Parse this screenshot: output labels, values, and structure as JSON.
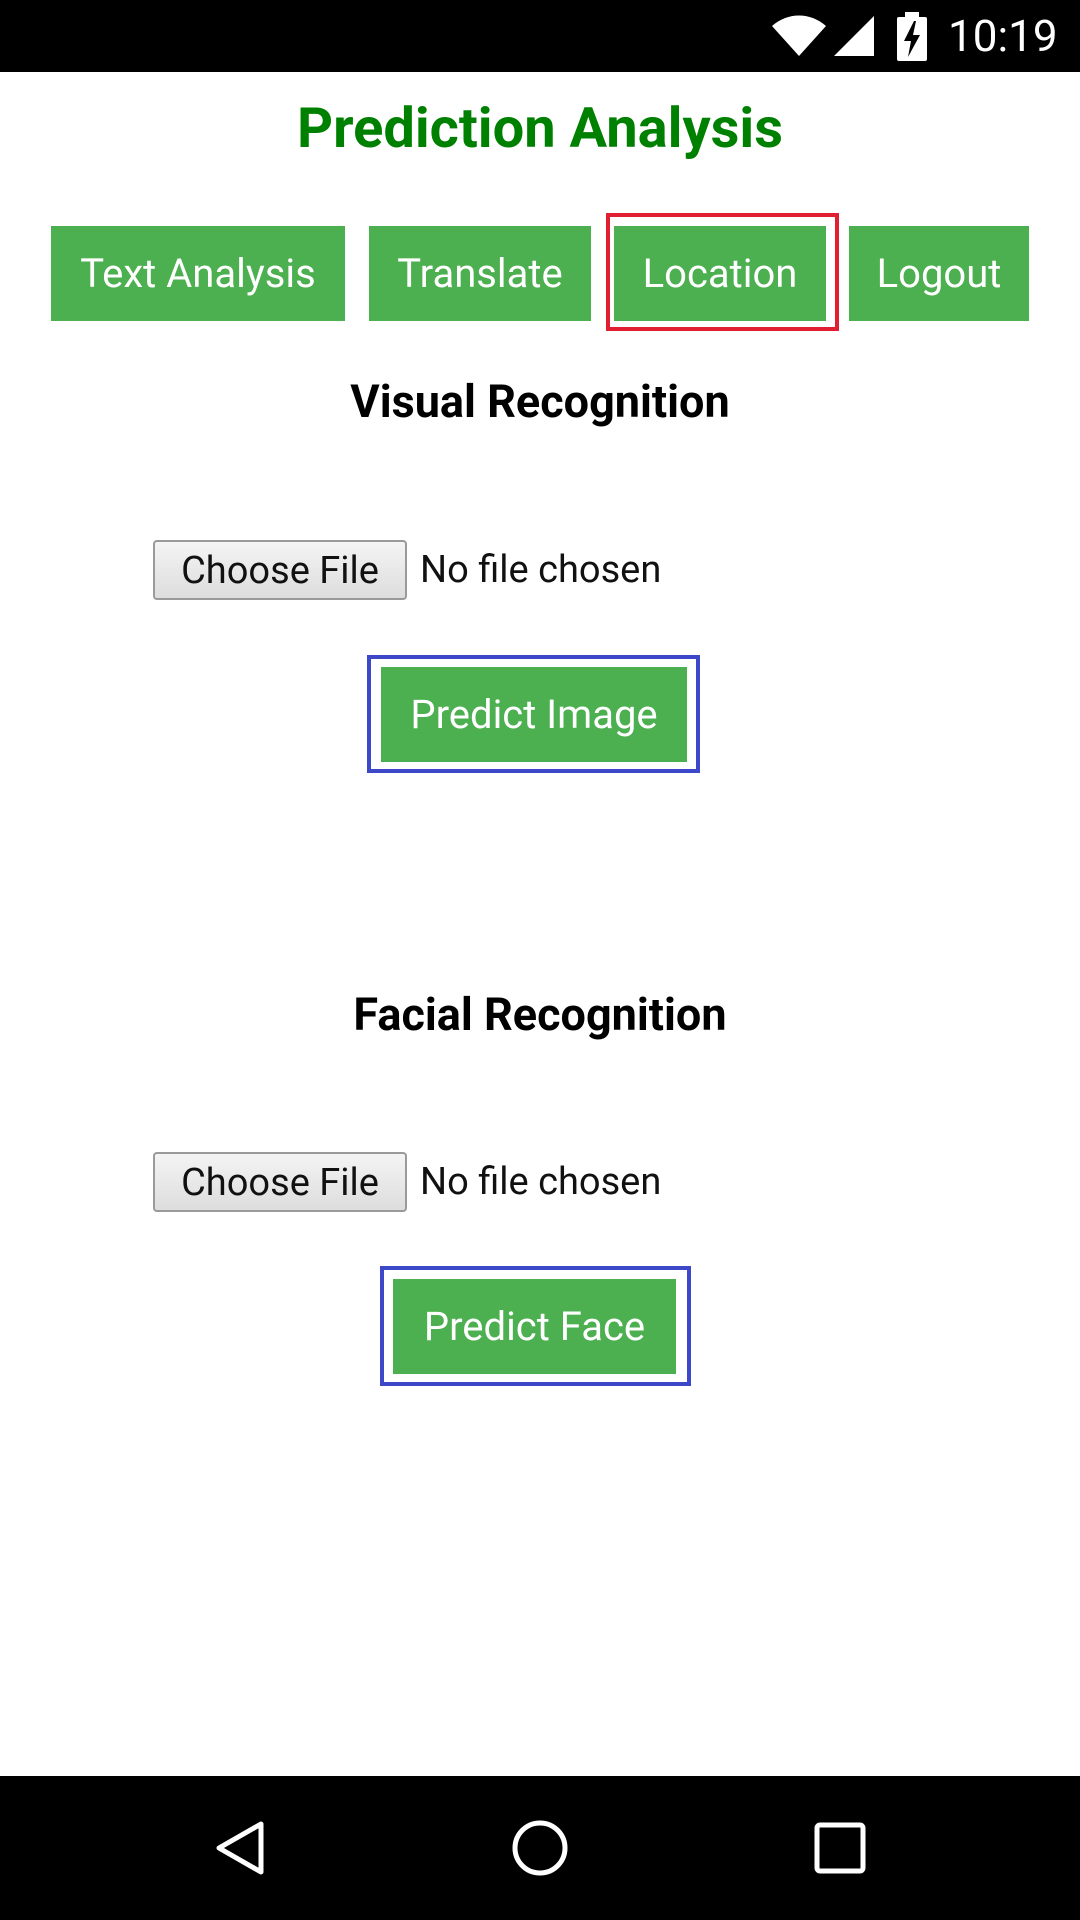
{
  "status_bar": {
    "time": "10:19",
    "icons": [
      "wifi-icon",
      "signal-icon",
      "battery-charging-icon"
    ]
  },
  "page": {
    "title": "Prediction Analysis"
  },
  "nav": {
    "text_analysis": "Text Analysis",
    "translate": "Translate",
    "location": "Location",
    "logout": "Logout"
  },
  "visual": {
    "heading": "Visual Recognition",
    "choose_file": "Choose File",
    "file_status": "No file chosen",
    "predict_button": "Predict Image"
  },
  "facial": {
    "heading": "Facial Recognition",
    "choose_file": "Choose File",
    "file_status": "No file chosen",
    "predict_button": "Predict Face"
  },
  "system_nav": {
    "icons": [
      "back-icon",
      "home-icon",
      "recents-icon"
    ]
  },
  "colors": {
    "title_green": "#008000",
    "button_green": "#4caf50",
    "highlight_red": "#e02030",
    "highlight_blue": "#3d48c8"
  }
}
